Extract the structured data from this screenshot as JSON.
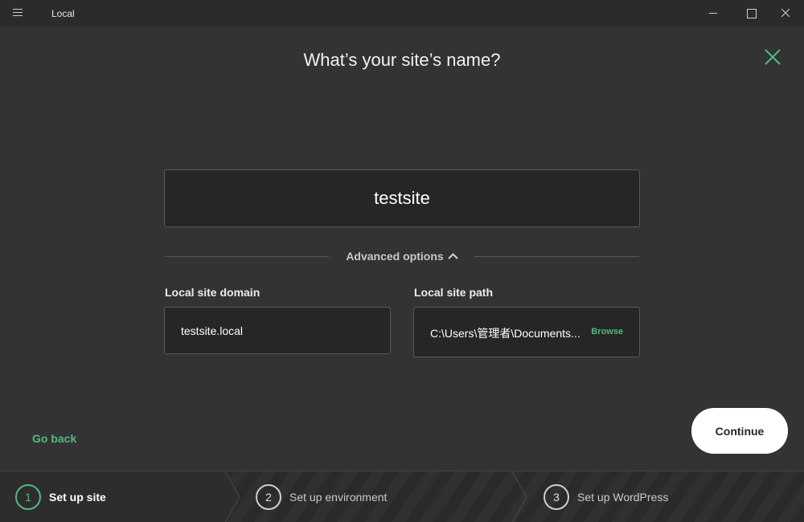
{
  "window": {
    "title": "Local"
  },
  "dialog": {
    "heading": "What’s your site’s name?"
  },
  "site_name": {
    "value": "testsite"
  },
  "advanced": {
    "toggle_label": "Advanced options"
  },
  "domain": {
    "label": "Local site domain",
    "value": "testsite.local"
  },
  "path": {
    "label": "Local site path",
    "value": "C:\\Users\\管理者\\Documents...",
    "browse_label": "Browse"
  },
  "actions": {
    "go_back": "Go back",
    "continue": "Continue"
  },
  "steps": [
    {
      "number": "1",
      "label": "Set up site",
      "active": true
    },
    {
      "number": "2",
      "label": "Set up environment",
      "active": false
    },
    {
      "number": "3",
      "label": "Set up WordPress",
      "active": false
    }
  ],
  "colors": {
    "accent": "#51bb7b",
    "background": "#333336",
    "titlebar": "#2b2b2d"
  }
}
